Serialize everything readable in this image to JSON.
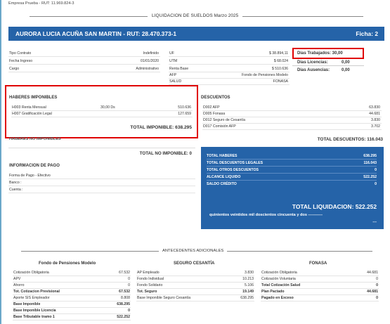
{
  "company": "Empresa Prueba - RUT: 11.969.824-3",
  "doc_title": "LIQUIDACION DE SUELDOS Marzo 2025",
  "employee": {
    "banner": "AURORA LUCIA ACUÑA SAN MARTIN - RUT: 28.470.373-1",
    "ficha": "Ficha: 2"
  },
  "contract": [
    {
      "label": "Tipo Contrato",
      "value": "Indefinido"
    },
    {
      "label": "Fecha Ingreso",
      "value": "01/01/2020"
    },
    {
      "label": "Cargo",
      "value": "Administrativo"
    }
  ],
  "indicators": [
    {
      "label": "UF",
      "value": "$ 38.894,11"
    },
    {
      "label": "UTM",
      "value": "$ 68.024"
    },
    {
      "label": "Renta Base",
      "value": "$ 510.636"
    },
    {
      "label": "AFP",
      "value": "Fondo de Pensiones Modelo"
    },
    {
      "label": "SALUD",
      "value": "FONASA"
    }
  ],
  "days": {
    "trabajados": "Dias Trabajados: 30,00",
    "licencias_label": "Dias Licencias:",
    "licencias_value": "0,00",
    "ausencias_label": "Dias Ausencias:",
    "ausencias_value": "0,00"
  },
  "haberes_imponibles": {
    "title": "HABERES IMPONIBLES",
    "items": [
      {
        "label": "H003 Renta Mensual",
        "qty": "30,00 Ds",
        "value": "510.636"
      },
      {
        "label": "H007 Gratificación Legal",
        "qty": "",
        "value": "127.659"
      }
    ],
    "total": "TOTAL IMPONIBLE: 638.295"
  },
  "haberes_no_imponibles": {
    "title": "HABERES NO IMPONIBLES",
    "total": "TOTAL NO IMPONIBLE: 0"
  },
  "descuentos": {
    "title": "DESCUENTOS",
    "items": [
      {
        "label": "D002 AFP",
        "value": "63.830"
      },
      {
        "label": "D005 Fonasa",
        "value": "44.681"
      },
      {
        "label": "D012 Seguro de Cesantía",
        "value": "3.830"
      },
      {
        "label": "D017 Comisión AFP",
        "value": "3.702"
      }
    ],
    "total": "TOTAL DESCUENTOS: 116.043"
  },
  "pago": {
    "title": "INFORMACION DE PAGO",
    "lines": [
      "Forma de Pago - Efectivo",
      "Banco :",
      "Cuenta :"
    ]
  },
  "summary": {
    "items": [
      {
        "label": "TOTAL HABERES",
        "value": "638.295"
      },
      {
        "label": "TOTAL DESCUENTOS LEGALES",
        "value": "116.043"
      },
      {
        "label": "TOTAL OTROS DESCUENTOS",
        "value": "0"
      },
      {
        "label": "ALCANCE LIQUIDO",
        "value": "522.252"
      },
      {
        "label": "SALDO CRÉDITO",
        "value": "0"
      }
    ],
    "liquidacion": "TOTAL LIQUIDACION: 522.252",
    "words": "quinientos veintidos mil doscientos cincuenta y dos -----------",
    "words_tail": "---"
  },
  "antecedentes": {
    "title": "ANTECEDENTES ADICIONALES",
    "afp": {
      "title": "Fondo de Pensiones Modelo",
      "rows": [
        {
          "label": "Cotización Obligatoria",
          "value": "67.532",
          "bold": false
        },
        {
          "label": "APV",
          "value": "0",
          "bold": false
        },
        {
          "label": "Ahorro",
          "value": "0",
          "bold": false
        },
        {
          "label": "Tot. Cotizacion Previsional",
          "value": "67.532",
          "bold": true
        },
        {
          "label": "Aporte SIS Empleador",
          "value": "8.808",
          "bold": false
        },
        {
          "label": "Base Imponible",
          "value": "638.295",
          "bold": true
        },
        {
          "label": "Base Imponible Licencia",
          "value": "0",
          "bold": true
        },
        {
          "label": "Base Tributable tramo 1",
          "value": "522.252",
          "bold": true
        }
      ]
    },
    "cesantia": {
      "title": "SEGURO CESANTÍA",
      "rows": [
        {
          "label": "AP Empleado",
          "value": "3.830",
          "bold": false
        },
        {
          "label": "Fondo Individual",
          "value": "10.213",
          "bold": false
        },
        {
          "label": "Fondo Solidario",
          "value": "5.106",
          "bold": false
        },
        {
          "label": "Tot. Seguro",
          "value": "19.149",
          "bold": true
        },
        {
          "label": "Base Imponible Seguro Cesantía",
          "value": "638.295",
          "bold": false
        }
      ]
    },
    "fonasa": {
      "title": "FONASA",
      "rows": [
        {
          "label": "Cotización Obligatoria",
          "value": "44.681",
          "bold": false
        },
        {
          "label": "Cotización Voluntaria",
          "value": "0",
          "bold": false
        },
        {
          "label": "Total Cotización Salud",
          "value": "0",
          "bold": true
        },
        {
          "label": "Plan Pactado",
          "value": "44.681",
          "bold": true
        },
        {
          "label": "Pagado en Exceso",
          "value": "0",
          "bold": true
        }
      ]
    }
  },
  "colors": {
    "banner": "#2563a8",
    "highlight": "#e00000"
  }
}
